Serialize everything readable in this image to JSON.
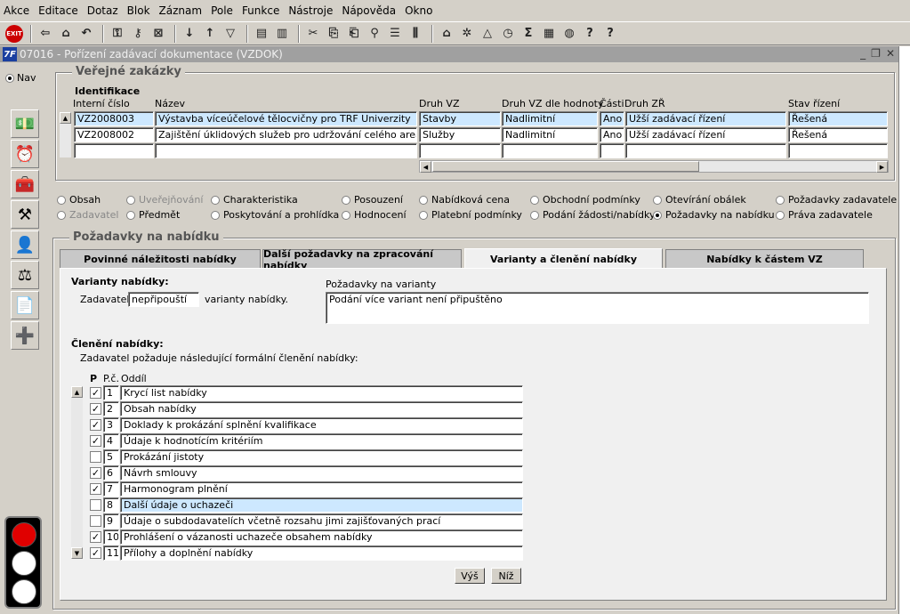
{
  "menu": [
    "Akce",
    "Editace",
    "Dotaz",
    "Blok",
    "Záznam",
    "Pole",
    "Funkce",
    "Nástroje",
    "Nápověda",
    "Okno"
  ],
  "toolbar": {
    "exit_label": "EXIT"
  },
  "window": {
    "title": "07016 - Pořízení zadávací dokumentace (VZDOK)",
    "logo": "7F"
  },
  "nav": {
    "label": "Nav"
  },
  "verejne": {
    "title": "Veřejné zakázky",
    "section": "Identifikace",
    "headers": {
      "interni": "Interní číslo",
      "nazev": "Název",
      "druh": "Druh VZ",
      "druh_hodnoty": "Druh VZ dle hodnoty",
      "casti": "Části",
      "druh_zr": "Druh ZŘ",
      "stav": "Stav řízení"
    },
    "rows": [
      {
        "interni": "VZ2008003",
        "nazev": "Výstavba víceúčelové tělocvičny pro TRF Univerzity",
        "druh": "Stavby",
        "druh_hodnoty": "Nadlimitní",
        "casti": "Ano",
        "druh_zr": "Užší zadávací řízení",
        "stav": "Řešená"
      },
      {
        "interni": "VZ2008002",
        "nazev": "Zajištění úklidových služeb pro udržování celého areálu Univ",
        "druh": "Služby",
        "druh_hodnoty": "Nadlimitní",
        "casti": "Ano",
        "druh_zr": "Užší zadávací řízení",
        "stav": "Řešená"
      }
    ]
  },
  "radios": [
    {
      "label": "Obsah",
      "on": false,
      "dis": false
    },
    {
      "label": "Uveřejňování",
      "on": false,
      "dis": true
    },
    {
      "label": "Charakteristika",
      "on": false,
      "dis": false
    },
    {
      "label": "Posouzení",
      "on": false,
      "dis": false
    },
    {
      "label": "Nabídková cena",
      "on": false,
      "dis": false
    },
    {
      "label": "Obchodní podmínky",
      "on": false,
      "dis": false
    },
    {
      "label": "Otevírání obálek",
      "on": false,
      "dis": false
    },
    {
      "label": "Požadavky zadavatele",
      "on": false,
      "dis": false
    },
    {
      "label": "Zadavatel",
      "on": false,
      "dis": true
    },
    {
      "label": "Předmět",
      "on": false,
      "dis": false
    },
    {
      "label": "Poskytování a prohlídka",
      "on": false,
      "dis": false
    },
    {
      "label": "Hodnocení",
      "on": false,
      "dis": false
    },
    {
      "label": "Platební podmínky",
      "on": false,
      "dis": false
    },
    {
      "label": "Podání žádosti/nabídky",
      "on": false,
      "dis": false
    },
    {
      "label": "Požadavky na nabídku",
      "on": true,
      "dis": false
    },
    {
      "label": "Práva zadavatele",
      "on": false,
      "dis": false
    }
  ],
  "pozadavky": {
    "title": "Požadavky na nabídku",
    "tabs": [
      "Povinné náležitosti nabídky",
      "Další požadavky na zpracování nabídky",
      "Varianty a členění nabídky",
      "Nabídky k částem VZ"
    ],
    "varianty_title": "Varianty nabídky:",
    "zadavatel_label": "Zadavatel",
    "zadavatel_value": "nepřipouští",
    "varianty_suffix": "varianty nabídky.",
    "pozadavky_label": "Požadavky na varianty",
    "pozadavky_text": "Podání více variant není připuštěno",
    "cleneni_title": "Členění nabídky:",
    "cleneni_desc": "Zadavatel požaduje následující formální členění nabídky:",
    "col_p": "P",
    "col_pc": "P.č.",
    "col_oddil": "Oddíl",
    "items": [
      {
        "num": "1",
        "label": "Krycí list nabídky",
        "checked": true
      },
      {
        "num": "2",
        "label": "Obsah nabídky",
        "checked": true
      },
      {
        "num": "3",
        "label": "Doklady k prokázání splnění kvalifikace",
        "checked": true
      },
      {
        "num": "4",
        "label": "Údaje k hodnotícím kritériím",
        "checked": true
      },
      {
        "num": "5",
        "label": "Prokázání jistoty",
        "checked": false
      },
      {
        "num": "6",
        "label": "Návrh smlouvy",
        "checked": true
      },
      {
        "num": "7",
        "label": "Harmonogram plnění",
        "checked": true
      },
      {
        "num": "8",
        "label": "Další údaje o uchazeči",
        "checked": false
      },
      {
        "num": "9",
        "label": "Údaje o subdodavatelích včetně rozsahu jimi zajišťovaných prací",
        "checked": false
      },
      {
        "num": "10",
        "label": "Prohlášení o vázanosti uchazeče obsahem nabídky",
        "checked": true
      },
      {
        "num": "11",
        "label": "Přílohy a doplnění nabídky",
        "checked": true
      }
    ],
    "btn_up": "Výš",
    "btn_down": "Níž"
  }
}
